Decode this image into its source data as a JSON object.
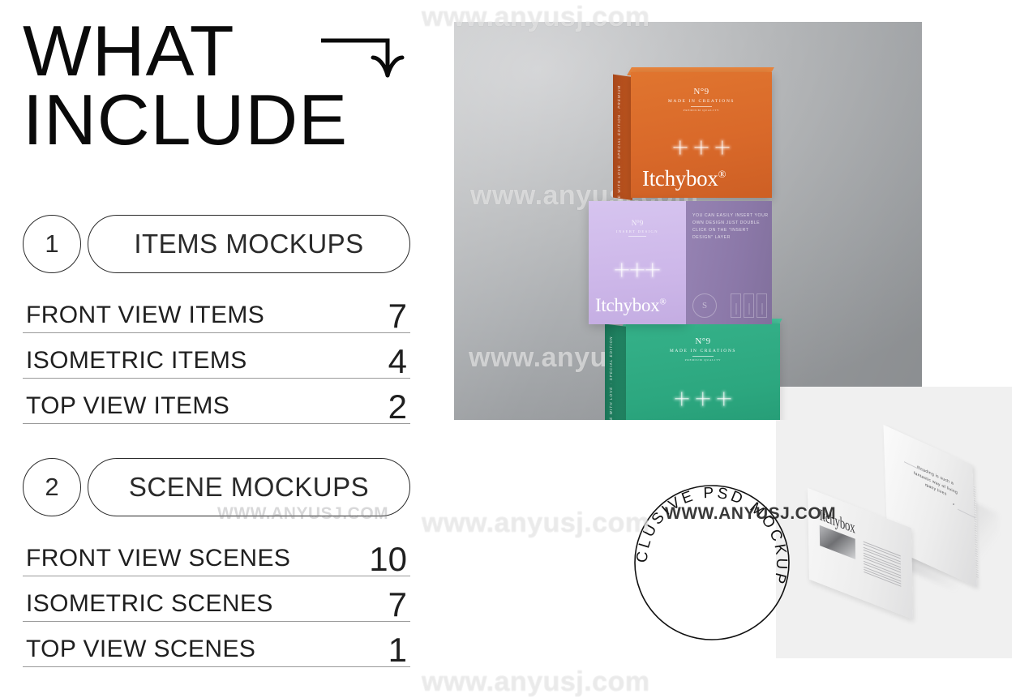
{
  "title": {
    "line1": "WHAT",
    "line2": "INCLUDE",
    "arrow_icon": "curved-down-arrow-icon"
  },
  "sections": [
    {
      "number": "1",
      "heading": "ITEMS MOCKUPS",
      "rows": [
        {
          "label": "FRONT VIEW ITEMS",
          "value": "7"
        },
        {
          "label": "ISOMETRIC ITEMS",
          "value": "4"
        },
        {
          "label": "TOP VIEW ITEMS",
          "value": "2"
        }
      ]
    },
    {
      "number": "2",
      "heading": "SCENE MOCKUPS",
      "rows": [
        {
          "label": "FRONT VIEW SCENES",
          "value": "10"
        },
        {
          "label": "ISOMETRIC SCENES",
          "value": "7"
        },
        {
          "label": "TOP VIEW SCENES",
          "value": "1"
        }
      ]
    }
  ],
  "badge": {
    "text": "EXCLUSIVE PSD MOCKUP"
  },
  "photo": {
    "boxes": [
      {
        "id": "orange-box",
        "color": "#d9692a",
        "no": "N°9",
        "made": "MADE IN CREATIONS",
        "tiny": "PREMIUM QUALITY",
        "brand": "Itchybox",
        "registered": "®",
        "side_text": "MADE WITH LOVE · SPECIAL EDITION · PREMIUM"
      },
      {
        "id": "purple-box",
        "color_light": "#cdb7e9",
        "color_dark": "#8b78a8",
        "no": "N°9",
        "made": "INSERT DESIGN",
        "brand": "Itchybox",
        "registered": "®",
        "note": "YOU CAN EASILY INSERT YOUR OWN DESIGN JUST DOUBLE CLICK ON THE \"INSERT DESIGN\" LAYER",
        "seal_letter": "S"
      },
      {
        "id": "green-box",
        "color": "#2ca77f",
        "no": "N°9",
        "made": "MADE IN CREATIONS",
        "tiny": "PREMIUM QUALITY",
        "side_text": "MADE WITH LOVE · SPECIAL EDITION"
      }
    ]
  },
  "book": {
    "headline": "Itchybox",
    "quote": "Reading is such a fantastic way of living many lives"
  },
  "watermarks": {
    "site": "www.anyusj.com",
    "site_upper": "WWW.ANYUSJ.COM"
  },
  "colors": {
    "ink": "#111111",
    "rule": "#9a9a9a",
    "photo_bg": "#b9bbbd",
    "panel_bg": "#f0f0f0",
    "orange": "#d9692a",
    "purple_light": "#cdb7e9",
    "purple_dark": "#8b78a8",
    "green": "#2ca77f"
  }
}
